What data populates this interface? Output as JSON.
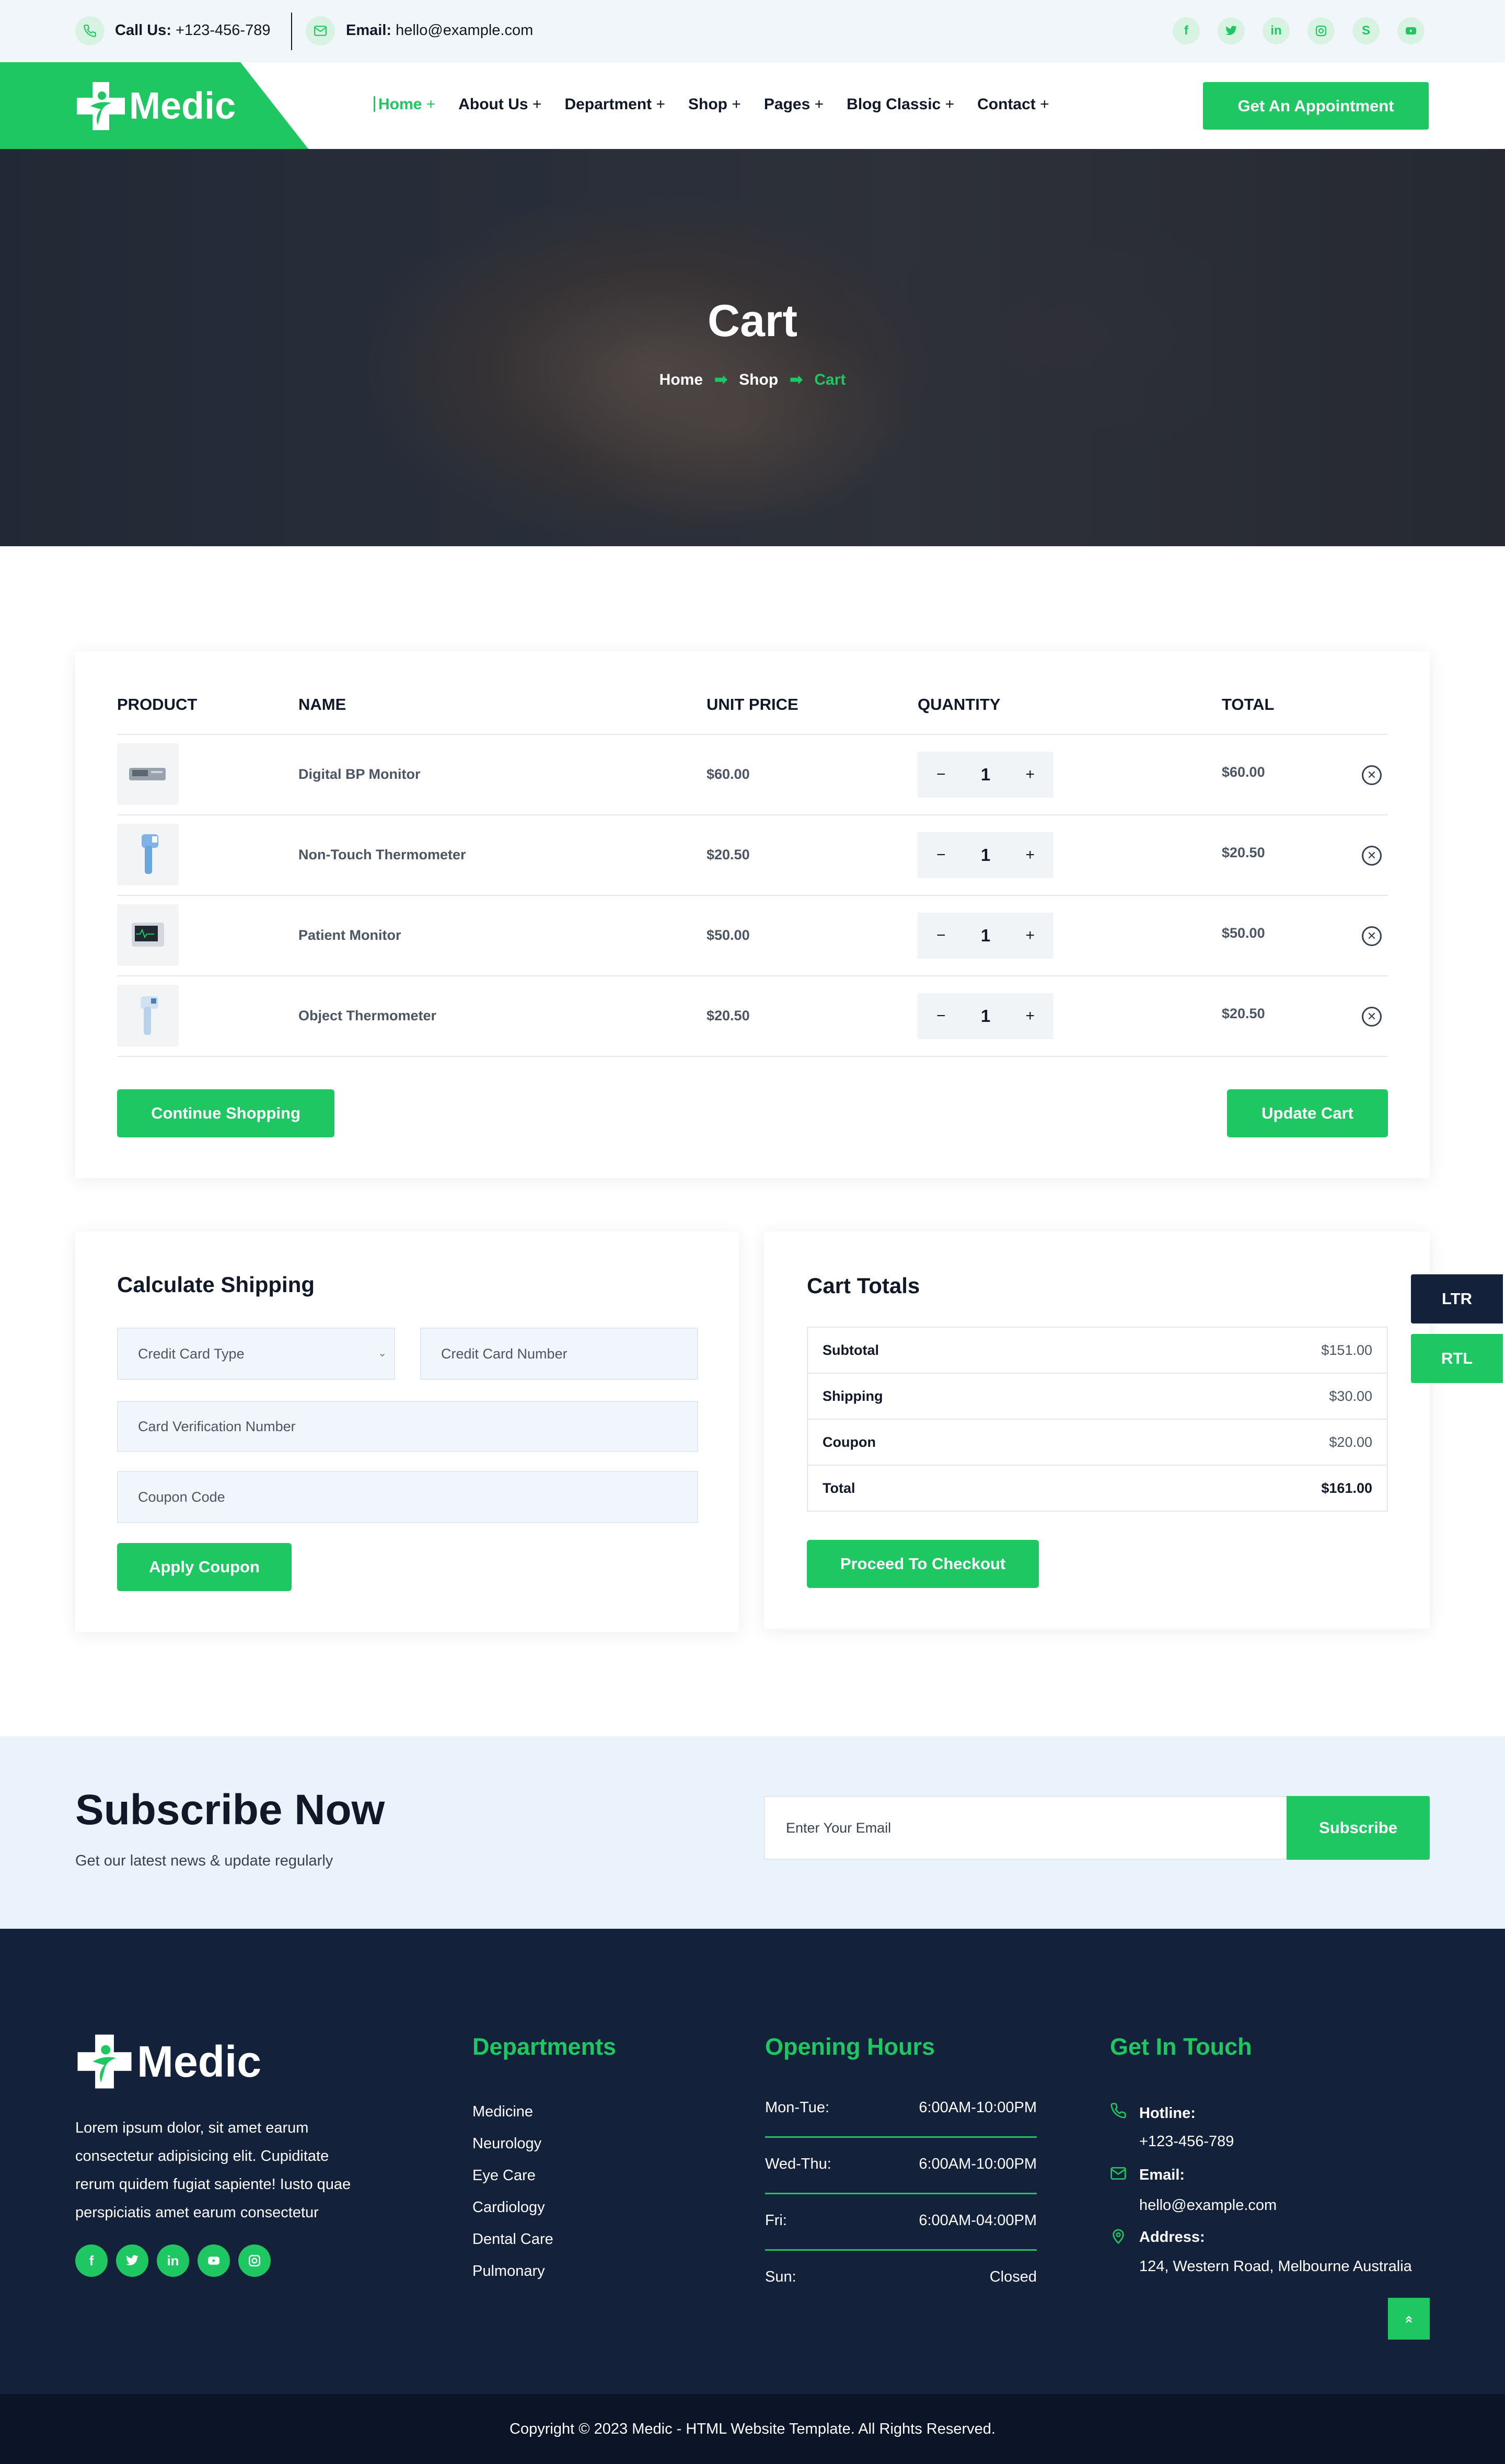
{
  "topbar": {
    "call_label": "Call Us:",
    "call_value": "+123-456-789",
    "email_label": "Email:",
    "email_value": "hello@example.com",
    "social": [
      "f",
      "t",
      "in",
      "ig",
      "s",
      "yt"
    ]
  },
  "header": {
    "logo_text": "Medic",
    "nav": [
      {
        "label": "Home",
        "active": true
      },
      {
        "label": "About Us"
      },
      {
        "label": "Department"
      },
      {
        "label": "Shop"
      },
      {
        "label": "Pages"
      },
      {
        "label": "Blog Classic"
      },
      {
        "label": "Contact"
      }
    ],
    "cta_label": "Get An Appointment"
  },
  "hero": {
    "title": "Cart",
    "breadcrumb": [
      "Home",
      "Shop",
      "Cart"
    ]
  },
  "cart": {
    "columns": [
      "PRODUCT",
      "NAME",
      "UNIT PRICE",
      "QUANTITY",
      "TOTAL"
    ],
    "rows": [
      {
        "name": "Digital BP Monitor",
        "unit_price": "$60.00",
        "quantity": "1",
        "total": "$60.00",
        "thumb": "bp-monitor-icon"
      },
      {
        "name": "Non-Touch Thermometer",
        "unit_price": "$20.50",
        "quantity": "1",
        "total": "$20.50",
        "thumb": "thermometer-gun-icon"
      },
      {
        "name": "Patient Monitor",
        "unit_price": "$50.00",
        "quantity": "1",
        "total": "$50.00",
        "thumb": "patient-monitor-icon"
      },
      {
        "name": "Object Thermometer",
        "unit_price": "$20.50",
        "quantity": "1",
        "total": "$20.50",
        "thumb": "object-thermometer-icon"
      }
    ],
    "continue_label": "Continue Shopping",
    "update_label": "Update Cart"
  },
  "shipping": {
    "title": "Calculate Shipping",
    "card_type_placeholder": "Credit Card Type",
    "card_number_placeholder": "Credit Card Number",
    "cvv_placeholder": "Card Verification Number",
    "coupon_placeholder": "Coupon Code",
    "apply_label": "Apply Coupon"
  },
  "totals": {
    "title": "Cart Totals",
    "rows": [
      {
        "label": "Subtotal",
        "value": "$151.00"
      },
      {
        "label": "Shipping",
        "value": "$30.00"
      },
      {
        "label": "Coupon",
        "value": "$20.00"
      },
      {
        "label": "Total",
        "value": "$161.00"
      }
    ],
    "checkout_label": "Proceed To Checkout"
  },
  "direction": {
    "ltr": "LTR",
    "rtl": "RTL"
  },
  "subscribe": {
    "title": "Subscribe Now",
    "subtitle": "Get our latest news & update regularly",
    "placeholder": "Enter Your Email",
    "button": "Subscribe"
  },
  "footer": {
    "logo_text": "Medic",
    "about": [
      "Lorem ipsum dolor, sit amet earum",
      "consectetur adipisicing elit. Cupiditate",
      "rerum quidem fugiat sapiente! Iusto quae",
      "perspiciatis amet earum consectetur"
    ],
    "social": [
      "f",
      "t",
      "in",
      "yt",
      "ig"
    ],
    "departments_title": "Departments",
    "departments": [
      "Medicine",
      "Neurology",
      "Eye Care",
      "Cardiology",
      "Dental Care",
      "Pulmonary"
    ],
    "hours_title": "Opening Hours",
    "hours": [
      {
        "day": "Mon-Tue:",
        "time": "6:00AM-10:00PM"
      },
      {
        "day": "Wed-Thu:",
        "time": "6:00AM-10:00PM"
      },
      {
        "day": "Fri:",
        "time": "6:00AM-04:00PM"
      },
      {
        "day": "Sun:",
        "time": "Closed"
      }
    ],
    "contact_title": "Get In Touch",
    "hotline_label": "Hotline:",
    "hotline_value": "+123-456-789",
    "email_label": "Email:",
    "email_value": "hello@example.com",
    "address_label": "Address:",
    "address_value": "124, Western Road, Melbourne Australia",
    "copyright": "Copyright © 2023 Medic - HTML Website Template. All Rights Reserved."
  },
  "colors": {
    "accent": "#1ec761",
    "dark": "#13223a"
  }
}
